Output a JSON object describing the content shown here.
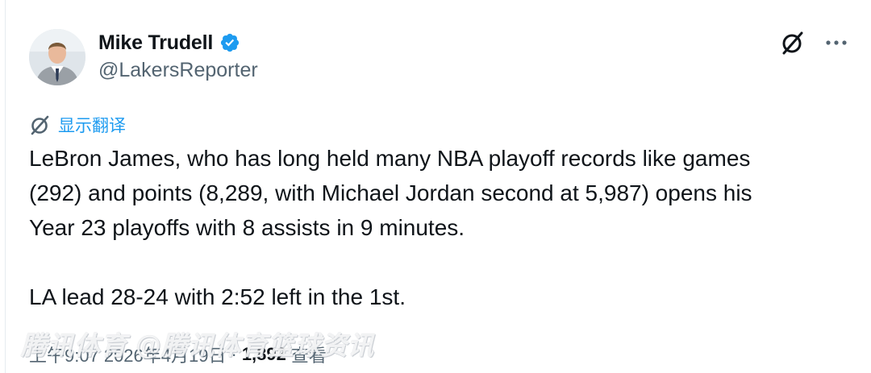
{
  "tweet": {
    "author": {
      "display_name": "Mike Trudell",
      "handle": "@LakersReporter",
      "verified": true,
      "verified_color": "#1d9bf0"
    },
    "actions": {
      "grok_icon": "grok-icon",
      "more_icon": "more-icon"
    },
    "translate_label": "显示翻译",
    "text_lines": [
      "LeBron James, who has long held many NBA playoff records like games",
      "(292) and points (8,289, with Michael Jordan second at 5,987) opens his",
      "Year 23 playoffs with 8 assists in 9 minutes.",
      "LA lead 28-24 with 2:52 left in the 1st."
    ],
    "meta": {
      "time": "上午9:07",
      "date": "2026年4月19日",
      "separator": "·",
      "views_count": "1,892",
      "views_label": "查看"
    },
    "watermark": "腾讯体育 @腾讯体育篮球资讯"
  },
  "colors": {
    "text": "#0f1419",
    "secondary": "#536471",
    "accent": "#1d9bf0"
  }
}
